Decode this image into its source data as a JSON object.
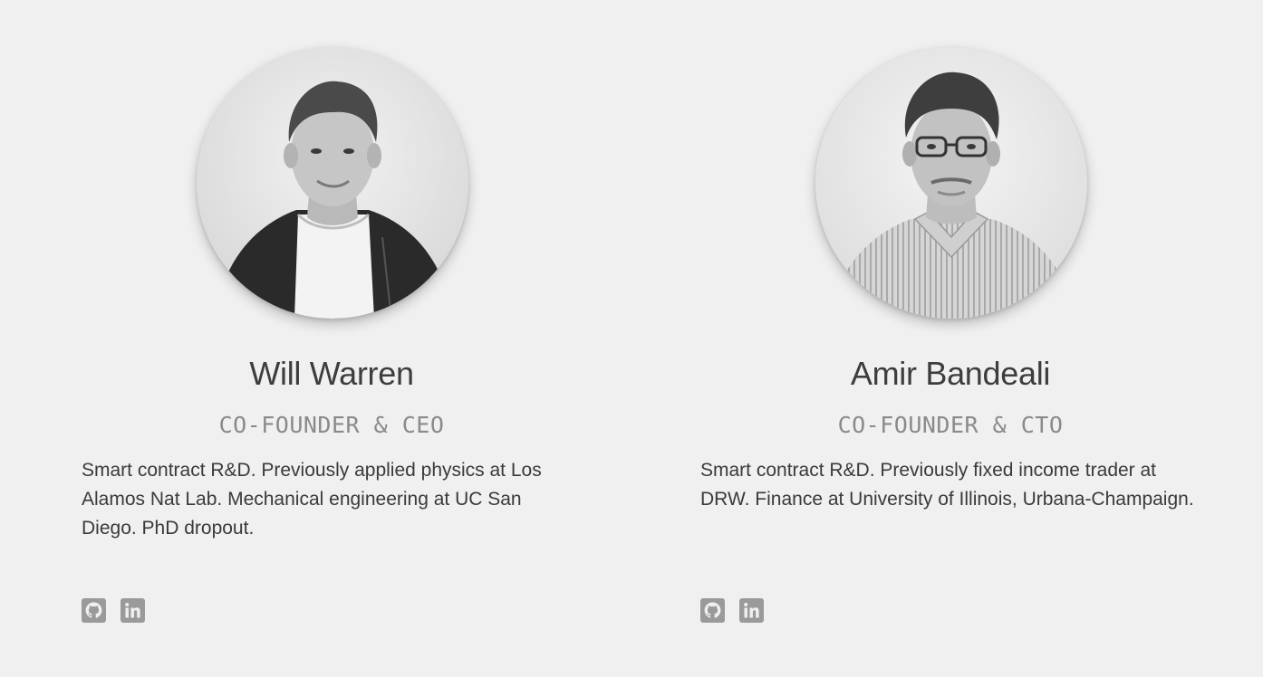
{
  "team": [
    {
      "name": "Will Warren",
      "role": "CO-FOUNDER & CEO",
      "bio": "Smart contract R&D. Previously applied physics at Los Alamos Nat Lab. Mechanical engineering at UC San Diego. PhD dropout.",
      "social": [
        "github-icon",
        "linkedin-icon"
      ]
    },
    {
      "name": "Amir Bandeali",
      "role": "CO-FOUNDER & CTO",
      "bio": "Smart contract R&D. Previously fixed income trader at DRW. Finance at University of Illinois, Urbana-Champaign.",
      "social": [
        "github-icon",
        "linkedin-icon"
      ]
    }
  ],
  "colors": {
    "background": "#f0f0f0",
    "name": "#3d3d3d",
    "role": "#8a8a8a",
    "icon": "#9a9a9a"
  }
}
